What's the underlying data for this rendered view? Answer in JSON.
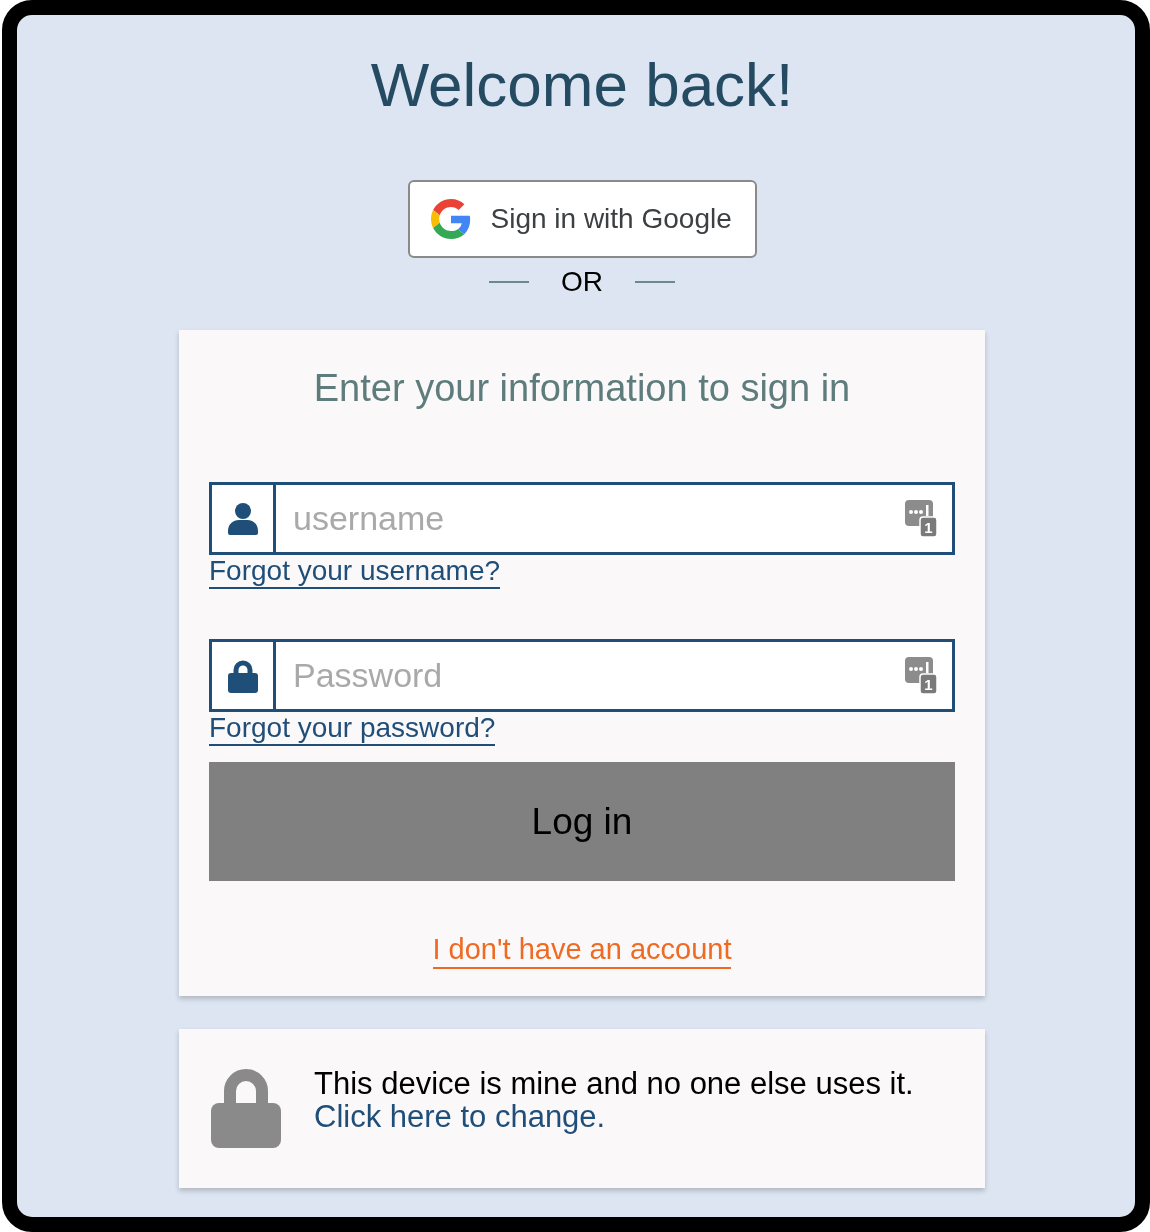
{
  "title": "Welcome back!",
  "google_button": {
    "label": "Sign in with Google"
  },
  "divider": {
    "label": "OR"
  },
  "login_card": {
    "heading": "Enter your information to sign in",
    "fields": [
      {
        "kind": "username",
        "placeholder": "username",
        "manager_badge": "1",
        "forgot_link": "Forgot your username?"
      },
      {
        "kind": "password",
        "placeholder": "Password",
        "manager_badge": "1",
        "forgot_link": "Forgot your password?"
      }
    ],
    "submit_button": {
      "label": "Log in"
    },
    "signup_link": "I don't have an account"
  },
  "device_card": {
    "message": "This device is mine and no one else uses it.",
    "link": "Click here to change."
  }
}
